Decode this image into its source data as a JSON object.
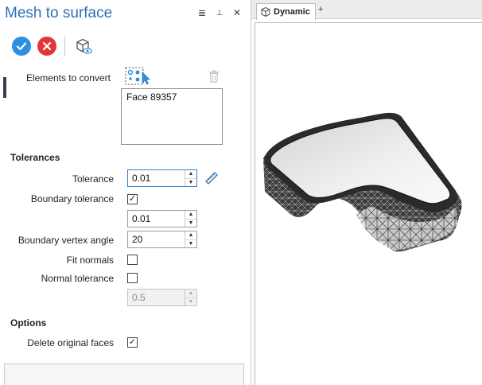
{
  "panel": {
    "title": "Mesh to surface",
    "title_tools": {
      "menu_glyph": "≣",
      "pin_glyph": "⊥",
      "close_glyph": "✕"
    },
    "actions": {
      "ok_icon": "check-icon",
      "cancel_icon": "x-icon",
      "preview_icon": "cube-eye-icon"
    }
  },
  "elements": {
    "label": "Elements to convert",
    "items": [
      "Face 89357"
    ]
  },
  "tolerances": {
    "heading": "Tolerances",
    "tolerance_label": "Tolerance",
    "tolerance_value": "0.01",
    "boundary_tolerance_label": "Boundary tolerance",
    "boundary_tolerance_checked": true,
    "boundary_tolerance_value": "0.01",
    "boundary_vertex_angle_label": "Boundary vertex angle",
    "boundary_vertex_angle_value": "20",
    "fit_normals_label": "Fit normals",
    "fit_normals_checked": false,
    "normal_tolerance_label": "Normal tolerance",
    "normal_tolerance_checked": false,
    "normal_tolerance_value": "0.5"
  },
  "options": {
    "heading": "Options",
    "delete_original_faces_label": "Delete original faces",
    "delete_original_faces_checked": true
  },
  "spin": {
    "up": "▲",
    "down": "▼"
  },
  "check_mark": "✓",
  "viewport": {
    "tab_label": "Dynamic",
    "add_tab": "+"
  },
  "colors": {
    "accent": "#2d6fbd",
    "ok": "#2f8fe0",
    "cancel": "#e23737"
  }
}
